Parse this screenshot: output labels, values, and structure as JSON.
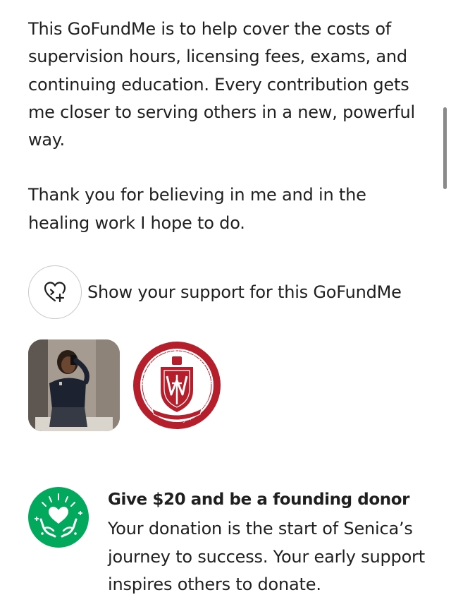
{
  "story": {
    "paragraph_1": "This GoFundMe is to help cover the costs of supervision hours, licensing fees, exams, and continuing education. Every contribution gets me closer to serving others in a new, powerful way.",
    "paragraph_2": "Thank you for believing in me and in the healing work I hope to do."
  },
  "support": {
    "label": "Show your support for this GoFundMe",
    "icon": "heart-plus-icon"
  },
  "media": {
    "logo_top_text": "WALSH UNIVERSITY",
    "logo_bottom_text": "A Catholic University of Distinction",
    "logo_color": "#b41f2b"
  },
  "founding": {
    "title": "Give $20 and be a founding donor",
    "description": "Your donation is the start of Senica’s journey to success. Your early support inspires others to donate.",
    "icon": "hands-heart-icon",
    "icon_color": "#02a95c"
  }
}
